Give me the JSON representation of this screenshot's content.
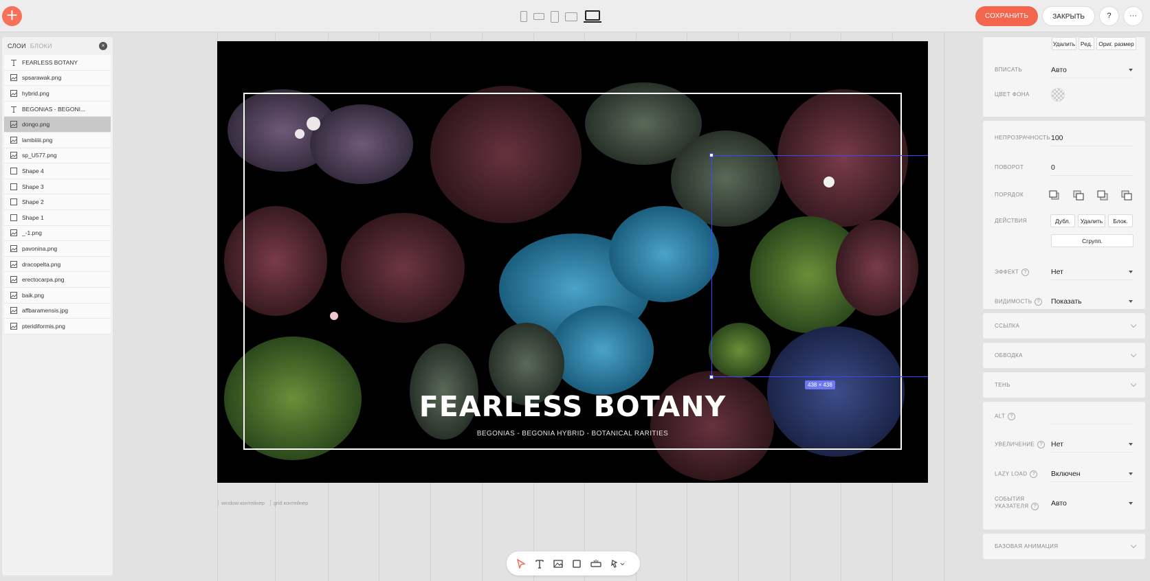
{
  "topbar": {
    "add_label": "+",
    "save_label": "СОХРАНИТЬ",
    "close_label": "ЗАКРЫТЬ",
    "help_label": "?",
    "more_label": "···"
  },
  "layers_panel": {
    "tab_layers": "СЛОИ",
    "tab_blocks": "БЛОКИ",
    "close_label": "×",
    "items": [
      {
        "type": "text",
        "label": "FEARLESS BOTANY"
      },
      {
        "type": "image",
        "label": "spsarawak.png"
      },
      {
        "type": "image",
        "label": "hybrid.png"
      },
      {
        "type": "text",
        "label": "BEGONIAS - BEGONI..."
      },
      {
        "type": "image",
        "label": "dongo.png",
        "selected": true
      },
      {
        "type": "image",
        "label": "lambiiiii.png"
      },
      {
        "type": "image",
        "label": "sp_U577.png"
      },
      {
        "type": "shape",
        "label": "Shape 4"
      },
      {
        "type": "shape",
        "label": "Shape 3"
      },
      {
        "type": "shape",
        "label": "Shape 2"
      },
      {
        "type": "shape",
        "label": "Shape 1"
      },
      {
        "type": "image",
        "label": "_-1.png"
      },
      {
        "type": "image",
        "label": "pavonina.png"
      },
      {
        "type": "image",
        "label": "dracopelta.png"
      },
      {
        "type": "image",
        "label": "erectocarpa.png"
      },
      {
        "type": "image",
        "label": "baik.png"
      },
      {
        "type": "image",
        "label": "affbaramensis.jpg"
      },
      {
        "type": "image",
        "label": "pteridiformis.png"
      }
    ]
  },
  "canvas": {
    "headline": "FEARLESS BOTANY",
    "subline": "BEGONIAS - BEGONIA HYBRID - BOTANICAL RARITIES",
    "size_badge": "438 × 438",
    "container_labels": [
      "window контейнер",
      "grid контейнер"
    ]
  },
  "properties": {
    "image_buttons": [
      "Удалить",
      "Ред.",
      "Ориг. размер"
    ],
    "fit_label": "ВПИСАТЬ",
    "fit_value": "Авто",
    "bg_color_label": "ЦВЕТ ФОНА",
    "opacity_label": "НЕПРОЗРАЧНОСТЬ",
    "opacity_value": "100",
    "rotation_label": "ПОВОРОТ",
    "rotation_value": "0",
    "order_label": "ПОРЯДОК",
    "actions_label": "ДЕЙСТВИЯ",
    "action_buttons": [
      "Дубл.",
      "Удалить",
      "Блок."
    ],
    "group_button": "Сгрупп.",
    "effect_label": "ЭФФЕКТ",
    "effect_value": "Нет",
    "visibility_label": "ВИДИМОСТЬ",
    "visibility_value": "Показать",
    "link_section": "ССЫЛКА",
    "stroke_section": "ОБВОДКА",
    "shadow_section": "ТЕНЬ",
    "alt_label": "ALT",
    "zoom_label": "УВЕЛИЧЕНИЕ",
    "zoom_value": "Нет",
    "lazy_label": "LAZY LOAD",
    "lazy_value": "Включен",
    "pointer_label": "СОБЫТИЯ УКАЗАТЕЛЯ",
    "pointer_value": "Авто",
    "animation_section": "БАЗОВАЯ АНИМАЦИЯ"
  },
  "colors": {
    "accent": "#f3654d",
    "selection": "#3a47ff",
    "artboard_bg": "#000000"
  }
}
